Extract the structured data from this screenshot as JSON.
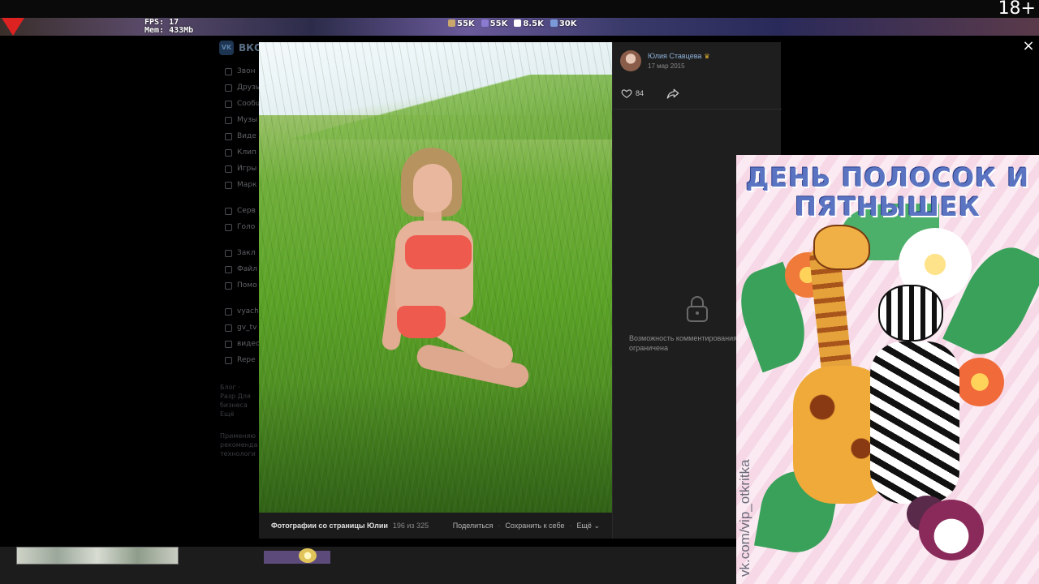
{
  "overlay": {
    "fps": "FPS: 17",
    "mem": "Mem: 433Mb",
    "stats": [
      {
        "value": "55",
        "unit": "K",
        "color": "#c9a76a"
      },
      {
        "value": "55",
        "unit": "K",
        "color": "#8a7ad0"
      },
      {
        "value": "8.5",
        "unit": "K",
        "color": "#ffffff"
      },
      {
        "value": "30",
        "unit": "K",
        "color": "#7a9ad8"
      }
    ],
    "age_rating": "18+"
  },
  "background_page": {
    "logo_text": "VK",
    "title": "ВКО",
    "sidebar_group1": [
      "Звон",
      "Друзь",
      "Сообщ",
      "Музы",
      "Виде",
      "Клип",
      "Игры",
      "Марк"
    ],
    "sidebar_group2": [
      "Серв",
      "Голо"
    ],
    "sidebar_group3": [
      "Закл",
      "Файл",
      "Помо"
    ],
    "sidebar_group4": [
      "vyach",
      "gv_tv",
      "видео",
      "Repe"
    ],
    "footer_links": "Блог · Разр Для бизнеса Ещё",
    "footer_note": "Применяю рекоменда технологи"
  },
  "viewer": {
    "author": {
      "name": "Юлия Ставцева",
      "date": "17 мар 2015"
    },
    "likes_count": "84",
    "comments_locked_text": "Возможность комментирования фотографии ограничена",
    "caption": {
      "album": "Фотографии со страницы Юлии",
      "counter": "196 из 325",
      "share": "Поделиться",
      "save": "Сохранить к себе",
      "more": "Ещё"
    },
    "close_symbol": "×"
  },
  "card": {
    "title_line1": "ДЕНЬ ПОЛОСОК И",
    "title_line2": "ПЯТНЫШЕК",
    "watermark": "vk.com/vip_otkritka"
  }
}
